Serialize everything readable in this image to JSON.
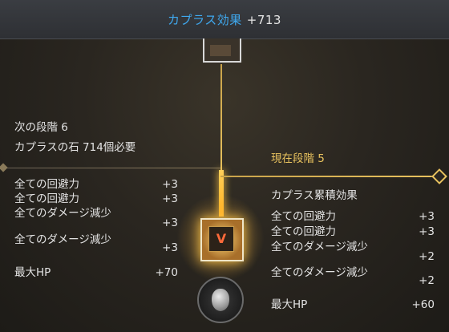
{
  "header": {
    "title": "カプラス効果",
    "value": "+713"
  },
  "next": {
    "stage_label": "次の段階 6",
    "stone_req": "カプラスの石 714個必要",
    "effects": [
      {
        "name": "全ての回避力",
        "value": "+3"
      },
      {
        "name": "全ての回避力",
        "value": "+3"
      },
      {
        "name": "全てのダメージ減少",
        "value": "+3"
      },
      {
        "name": "全てのダメージ減少",
        "value": "+3"
      },
      {
        "name": "最大HP",
        "value": "+70"
      }
    ]
  },
  "current": {
    "stage_label": "現在段階 5",
    "cumulative_title": "カプラス累積効果",
    "effects": [
      {
        "name": "全ての回避力",
        "value": "+3"
      },
      {
        "name": "全ての回避力",
        "value": "+3"
      },
      {
        "name": "全てのダメージ減少",
        "value": "+2"
      },
      {
        "name": "全てのダメージ減少",
        "value": "+2"
      },
      {
        "name": "最大HP",
        "value": "+60"
      }
    ]
  },
  "node_glyph": "V",
  "colors": {
    "title": "#3fa9f0",
    "gold": "#e8c25e",
    "node_glyph": "#ff6a3a"
  }
}
